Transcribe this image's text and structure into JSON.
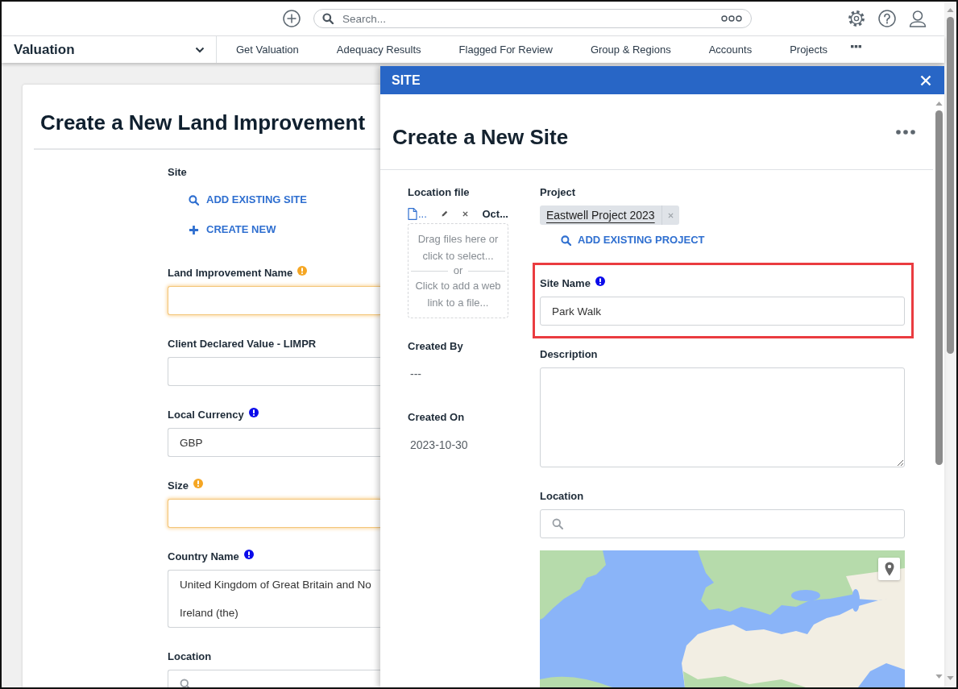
{
  "header": {
    "search": {
      "placeholder": "Search..."
    }
  },
  "nav": {
    "module": "Valuation",
    "items": [
      {
        "label": "Get Valuation",
        "selected": false
      },
      {
        "label": "Adequacy Results",
        "selected": false
      },
      {
        "label": "Flagged For Review",
        "selected": false
      },
      {
        "label": "Group & Regions",
        "selected": false
      },
      {
        "label": "Accounts",
        "selected": false
      },
      {
        "label": "Projects",
        "selected": false
      }
    ]
  },
  "form": {
    "title": "Create a New Land Improvement",
    "site": {
      "label": "Site",
      "actions": [
        {
          "kind": "search",
          "label": "ADD EXISTING SITE"
        },
        {
          "kind": "create",
          "label": "CREATE NEW"
        }
      ]
    },
    "fields": [
      {
        "label": "Land Improvement Name",
        "indicator": {
          "color": "#f5a623"
        },
        "kind": "text",
        "invalid": true
      },
      {
        "label": "Client Declared Value - LIMPR",
        "kind": "text",
        "invalid": false
      },
      {
        "label": "Local Currency",
        "indicator": {
          "color": "#0b0bea"
        },
        "kind": "text",
        "invalid": false,
        "value": "GBP"
      },
      {
        "label": "Size",
        "indicator": {
          "color": "#f5a623"
        },
        "kind": "text",
        "invalid": true
      },
      {
        "label": "Country Name",
        "indicator": {
          "color": "#0b0bea"
        },
        "kind": "multiline",
        "invalid": false,
        "value_lines": [
          "United Kingdom of Great Britain and No",
          "Ireland (the)"
        ]
      },
      {
        "label": "Location",
        "kind": "search",
        "invalid": false
      }
    ]
  },
  "dialog": {
    "header": "SITE",
    "title": "Create a New Site",
    "location_file": {
      "label": "Location file",
      "file_name": "...",
      "file_date": "Oct...",
      "drop_text": "Drag files here or click to select...",
      "separator": "or",
      "link_text": "Click to add a web link to a file..."
    },
    "meta": [
      {
        "label": "Created By",
        "value": "---"
      },
      {
        "label": "Created On",
        "value": "2023-10-30"
      }
    ],
    "project": {
      "label": "Project",
      "tag": "Eastwell Project 2023",
      "action": "ADD EXISTING PROJECT"
    },
    "fields": [
      {
        "label": "Site Name",
        "indicator": {
          "color": "#0b0bea"
        },
        "kind": "text",
        "value": "Park Walk",
        "highlighted": true
      },
      {
        "label": "Description",
        "kind": "textarea",
        "highlighted": false
      },
      {
        "label": "Location",
        "kind": "search",
        "highlighted": false
      }
    ]
  }
}
